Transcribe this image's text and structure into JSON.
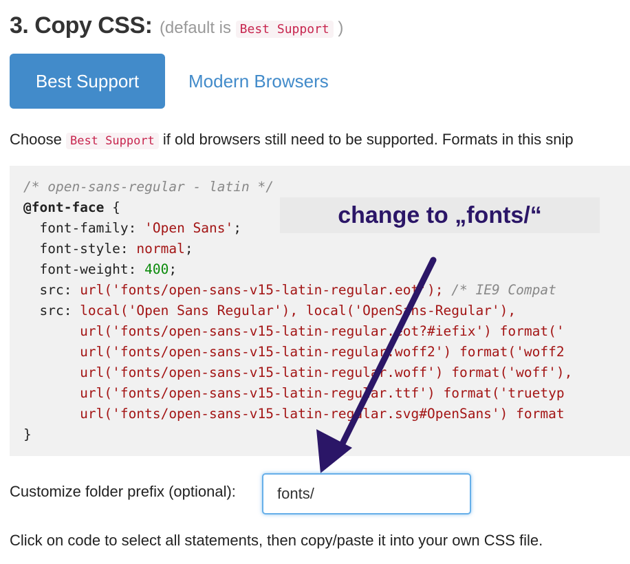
{
  "heading": {
    "title": "3. Copy CSS:",
    "default_prefix": "(default is",
    "default_tag": "Best Support",
    "default_suffix": ")"
  },
  "buttons": {
    "best_support": "Best Support",
    "modern_browsers": "Modern Browsers"
  },
  "description": {
    "before": "Choose",
    "tag": "Best Support",
    "after": "if old browsers still need to be supported. Formats in this snip"
  },
  "code": {
    "comment": "/* open-sans-regular - latin */",
    "at_rule": "@font-face",
    "open_brace": " {",
    "font_family_prop": "  font-family: ",
    "font_family_val": "'Open Sans'",
    "font_style_prop": "  font-style: ",
    "font_style_val": "normal",
    "font_weight_prop": "  font-weight: ",
    "font_weight_val": "400",
    "src1_prop": "  src: ",
    "src1_val": "url('fonts/open-sans-v15-latin-regular.eot');",
    "src1_comment": " /* IE9 Compat",
    "src2_prop": "  src: ",
    "src2_val": "local('Open Sans Regular'), local('OpenSans-Regular'),",
    "url_lines": [
      "       url('fonts/open-sans-v15-latin-regular.eot?#iefix') format('",
      "       url('fonts/open-sans-v15-latin-regular.woff2') format('woff2",
      "       url('fonts/open-sans-v15-latin-regular.woff') format('woff'),",
      "       url('fonts/open-sans-v15-latin-regular.ttf') format('truetyp",
      "       url('fonts/open-sans-v15-latin-regular.svg#OpenSans') format"
    ],
    "close_brace": "}"
  },
  "annotation": {
    "text": "change to „fonts/“",
    "color": "#2b1667"
  },
  "folder": {
    "label": "Customize folder prefix (optional):",
    "value": "fonts/"
  },
  "hint": "Click on code to select all statements, then copy/paste it into your own CSS file.",
  "colors": {
    "accent": "#428bca",
    "tag_text": "#c7254e",
    "tag_bg": "#f9f2f4",
    "code_bg": "#f1f1f1"
  }
}
